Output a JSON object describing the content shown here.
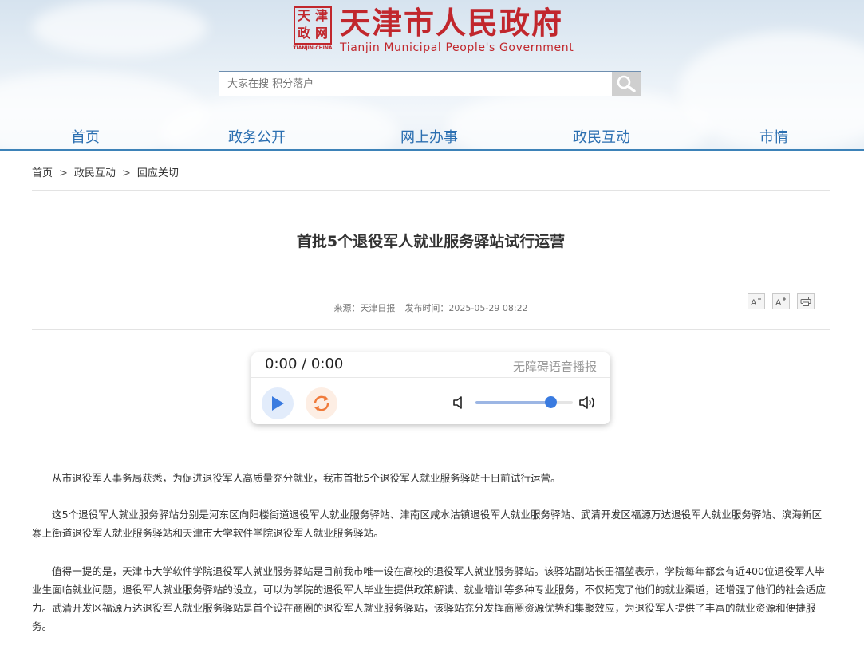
{
  "header": {
    "seal_chars": [
      "天",
      "津",
      "政",
      "网"
    ],
    "seal_en": "TIANJIN·CHINA",
    "title_cn": "天津市人民政府",
    "title_en": "Tianjin Municipal People's Government",
    "brand_color": "#c1272d"
  },
  "search": {
    "placeholder": "大家在搜 积分落户",
    "button_icon": "search-icon"
  },
  "nav": {
    "items": [
      "首页",
      "政务公开",
      "网上办事",
      "政民互动",
      "市情"
    ],
    "color": "#2b6fb1"
  },
  "breadcrumb": {
    "items": [
      "首页",
      "政民互动",
      "回应关切"
    ],
    "separator": ">"
  },
  "article": {
    "title": "首批5个退役军人就业服务驿站试行运营",
    "source": "来源：天津日报",
    "publish_time": "发布时间：2025-05-29 08:22",
    "tools": [
      "font-decrease-icon",
      "font-increase-icon",
      "print-icon"
    ],
    "paragraphs": [
      "从市退役军人事务局获悉，为促进退役军人高质量充分就业，我市首批5个退役军人就业服务驿站于日前试行运营。",
      "这5个退役军人就业服务驿站分别是河东区向阳楼街道退役军人就业服务驿站、津南区咸水沽镇退役军人就业服务驿站、武清开发区福源万达退役军人就业服务驿站、滨海新区寨上街道退役军人就业服务驿站和天津市大学软件学院退役军人就业服务驿站。",
      "值得一提的是，天津市大学软件学院退役军人就业服务驿站是目前我市唯一设在高校的退役军人就业服务驿站。该驿站副站长田福堃表示，学院每年都会有近400位退役军人毕业生面临就业问题，退役军人就业服务驿站的设立，可以为学院的退役军人毕业生提供政策解读、就业培训等多种专业服务，不仅拓宽了他们的就业渠道，还增强了他们的社会适应力。武清开发区福源万达退役军人就业服务驿站是首个设在商圈的退役军人就业服务驿站，该驿站充分发挥商圈资源优势和集聚效应，为退役军人提供了丰富的就业资源和便捷服务。"
    ]
  },
  "player": {
    "time": "0:00 / 0:00",
    "label": "无障碍语音播报",
    "volume_fraction": 0.77,
    "play_color": "#3a7be0",
    "replay_color": "#f07a3a"
  }
}
